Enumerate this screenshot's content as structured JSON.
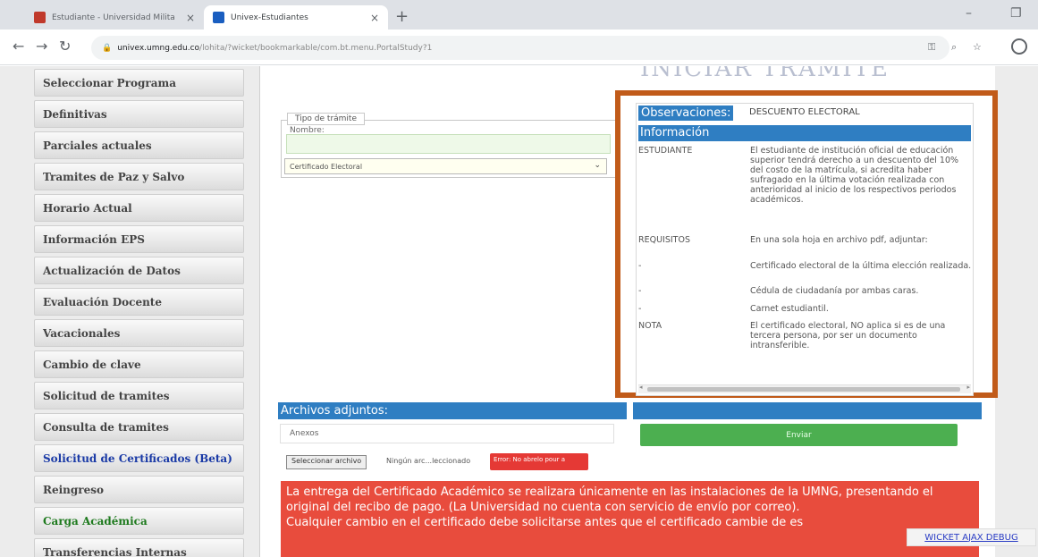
{
  "browser": {
    "tabs": [
      {
        "title": "Estudiante - Universidad Milita"
      },
      {
        "title": "Univex-Estudiantes"
      }
    ],
    "new_tab": "+",
    "tab_close": "×",
    "url_host": "univex.umng.edu.co",
    "url_path": "/lohita/?wicket/bookmarkable/com.bt.menu.PortalStudy?1",
    "win_minimize": "–",
    "win_restore": "❐"
  },
  "sidebar": {
    "items": [
      {
        "label": "Seleccionar Programa"
      },
      {
        "label": "Definitivas"
      },
      {
        "label": "Parciales actuales"
      },
      {
        "label": "Tramites de Paz y Salvo"
      },
      {
        "label": "Horario Actual"
      },
      {
        "label": "Información EPS"
      },
      {
        "label": "Actualización de Datos"
      },
      {
        "label": "Evaluación Docente"
      },
      {
        "label": "Vacacionales"
      },
      {
        "label": "Cambio de clave"
      },
      {
        "label": "Solicitud de tramites"
      },
      {
        "label": "Consulta de tramites"
      },
      {
        "label": "Solicitud de Certificados (Beta)"
      },
      {
        "label": "Reingreso"
      },
      {
        "label": "Carga Académica"
      },
      {
        "label": "Transferencias Internas"
      }
    ]
  },
  "main": {
    "heading": "INICIAR TRÁMITE",
    "form": {
      "legend": "Tipo de trámite",
      "nombre_label": "Nombre:",
      "selected_option": "Certificado Electoral"
    },
    "observaciones": {
      "label": "Observaciones:",
      "value": "DESCUENTO ELECTORAL",
      "info_header": "Información",
      "rows": [
        {
          "key": "ESTUDIANTE",
          "value": "El estudiante de institución oficial de educación superior tendrá derecho a un descuento del 10% del costo de la matrícula, si acredita haber sufragado en la última votación realizada con anterioridad al inicio de los respectivos periodos académicos."
        },
        {
          "key": "REQUISITOS",
          "value": "En una sola hoja en archivo pdf, adjuntar:"
        },
        {
          "key": "-",
          "value": "Certificado electoral de la última elección realizada."
        },
        {
          "key": "-",
          "value": "Cédula de ciudadanía por ambas caras."
        },
        {
          "key": "-",
          "value": "Carnet estudiantil."
        },
        {
          "key": "NOTA",
          "value": "El certificado electoral, NO aplica si es de una tercera persona, por ser un documento intransferible."
        }
      ]
    },
    "archivos": {
      "header": "Archivos adjuntos:",
      "anexos": "Anexos",
      "file_button": "Seleccionar archivo",
      "file_status": "Ningún arc...leccionado",
      "warning_chip": "Error: No abrelo pour a",
      "submit": "Enviar"
    },
    "notice": "La entrega del Certificado Académico se realizara únicamente en las instalaciones de la UMNG, presentando el original del recibo de pago. (La Universidad no cuenta con servicio de envío por correo).\nCualquier cambio en el certificado debe solicitarse antes que el certificado cambie de es",
    "debug_link": "WICKET AJAX DEBUG"
  },
  "colors": {
    "highlight_border": "#c15b1a",
    "section_blue": "#2f7ec2",
    "submit_green": "#4caf50",
    "notice_red": "#e84c3d"
  }
}
